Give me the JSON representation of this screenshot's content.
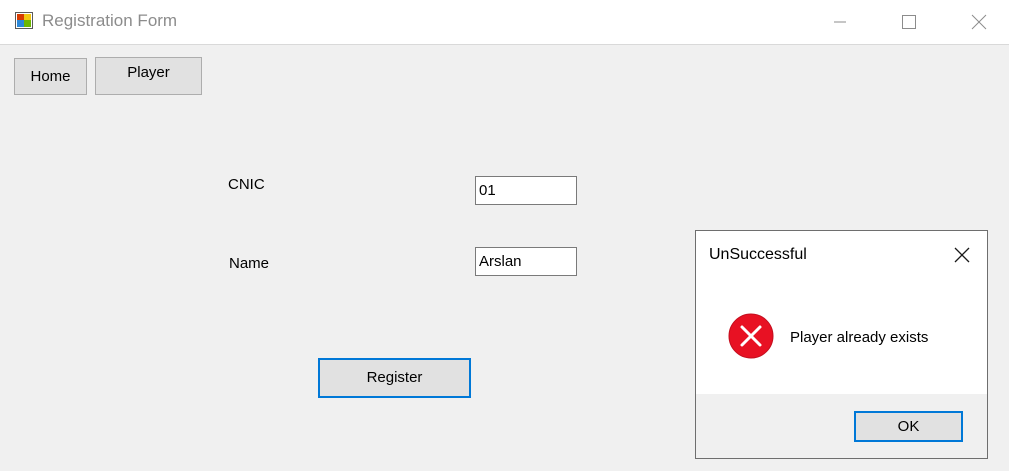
{
  "window": {
    "title": "Registration Form"
  },
  "toolbar": {
    "home_label": "Home",
    "player_label": "Player"
  },
  "form": {
    "cnic_label": "CNIC",
    "cnic_value": "01",
    "name_label": "Name",
    "name_value": "Arslan",
    "register_label": "Register"
  },
  "dialog": {
    "title": "UnSuccessful",
    "message": "Player already exists",
    "ok_label": "OK",
    "icon": "error-icon"
  },
  "colors": {
    "accent": "#0078d7",
    "error": "#e81123",
    "window_bg": "#f0f0f0"
  }
}
